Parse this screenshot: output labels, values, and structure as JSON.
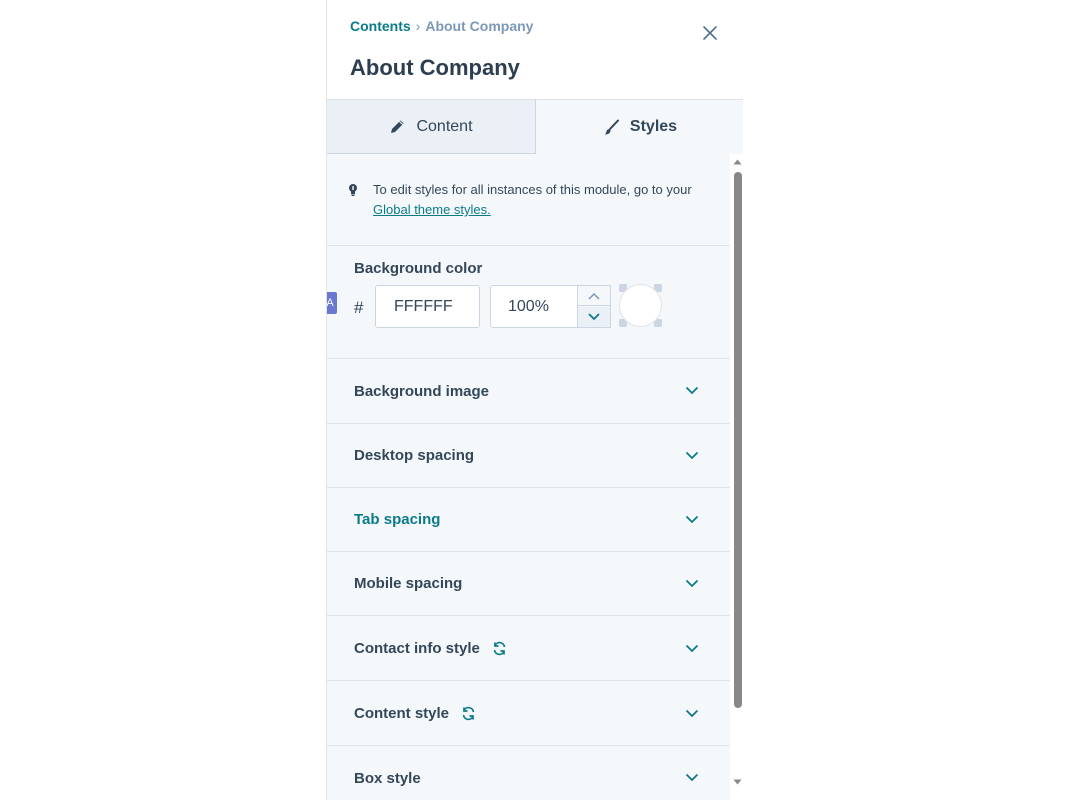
{
  "breadcrumb": {
    "root": "Contents",
    "separator": "›",
    "current": "About Company"
  },
  "header": {
    "title": "About Company",
    "close_icon": "close-icon"
  },
  "tabs": [
    {
      "label": "Content",
      "icon": "pencil-icon",
      "active": false
    },
    {
      "label": "Styles",
      "icon": "brush-icon",
      "active": true
    }
  ],
  "info": {
    "icon": "lightbulb-icon",
    "text": "To edit styles for all instances of this module, go to your ",
    "link_label": "Global theme styles."
  },
  "background_color": {
    "label": "Background color",
    "hash": "#",
    "hex_value": "FFFFFF",
    "opacity_value": "100%",
    "swatch_color": "#FFFFFF",
    "side_tag": "A"
  },
  "sections": [
    {
      "label": "Background image",
      "sync": false,
      "highlight": false
    },
    {
      "label": "Desktop spacing",
      "sync": false,
      "highlight": false
    },
    {
      "label": "Tab spacing",
      "sync": false,
      "highlight": true
    },
    {
      "label": "Mobile spacing",
      "sync": false,
      "highlight": false
    },
    {
      "label": "Contact info style",
      "sync": true,
      "highlight": false
    },
    {
      "label": "Content style",
      "sync": true,
      "highlight": false
    },
    {
      "label": "Box style",
      "sync": false,
      "highlight": false
    }
  ],
  "colors": {
    "accent": "#0b7b8b",
    "text": "#33475b",
    "panel_bg": "#f5f8fa",
    "border": "#dfe3eb",
    "tag": "#6a78d1"
  }
}
